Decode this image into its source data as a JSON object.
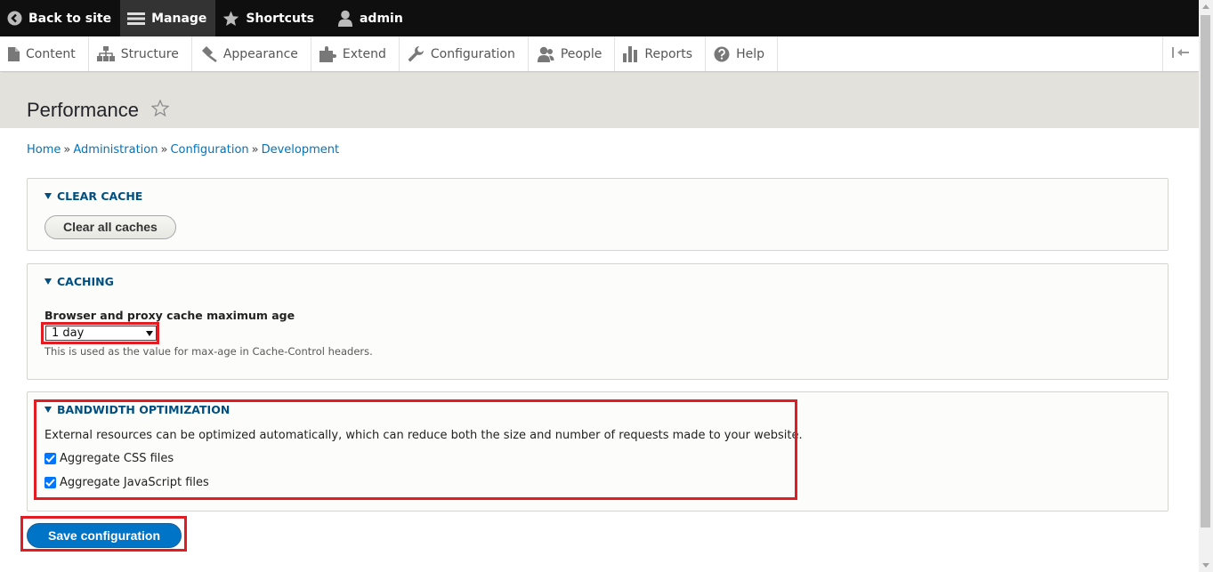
{
  "toolbar": {
    "back_to_site": "Back to site",
    "manage": "Manage",
    "shortcuts": "Shortcuts",
    "user": "admin"
  },
  "tray": {
    "items": [
      "Content",
      "Structure",
      "Appearance",
      "Extend",
      "Configuration",
      "People",
      "Reports",
      "Help"
    ]
  },
  "page": {
    "title": "Performance"
  },
  "breadcrumb": {
    "home": "Home",
    "administration": "Administration",
    "configuration": "Configuration",
    "development": "Development",
    "separator": "»"
  },
  "clear_cache": {
    "summary": "CLEAR CACHE",
    "button": "Clear all caches"
  },
  "caching": {
    "summary": "CACHING",
    "field_label": "Browser and proxy cache maximum age",
    "selected_value": "1 day",
    "description": "This is used as the value for max-age in Cache-Control headers."
  },
  "bandwidth": {
    "summary": "BANDWIDTH OPTIMIZATION",
    "description": "External resources can be optimized automatically, which can reduce both the size and number of requests made to your website.",
    "aggregate_css": "Aggregate CSS files",
    "aggregate_css_checked": true,
    "aggregate_js": "Aggregate JavaScript files",
    "aggregate_js_checked": true
  },
  "actions": {
    "save": "Save configuration"
  },
  "colors": {
    "link": "#0074bd",
    "primary_button": "#0074c6",
    "highlight": "#e31b23"
  }
}
